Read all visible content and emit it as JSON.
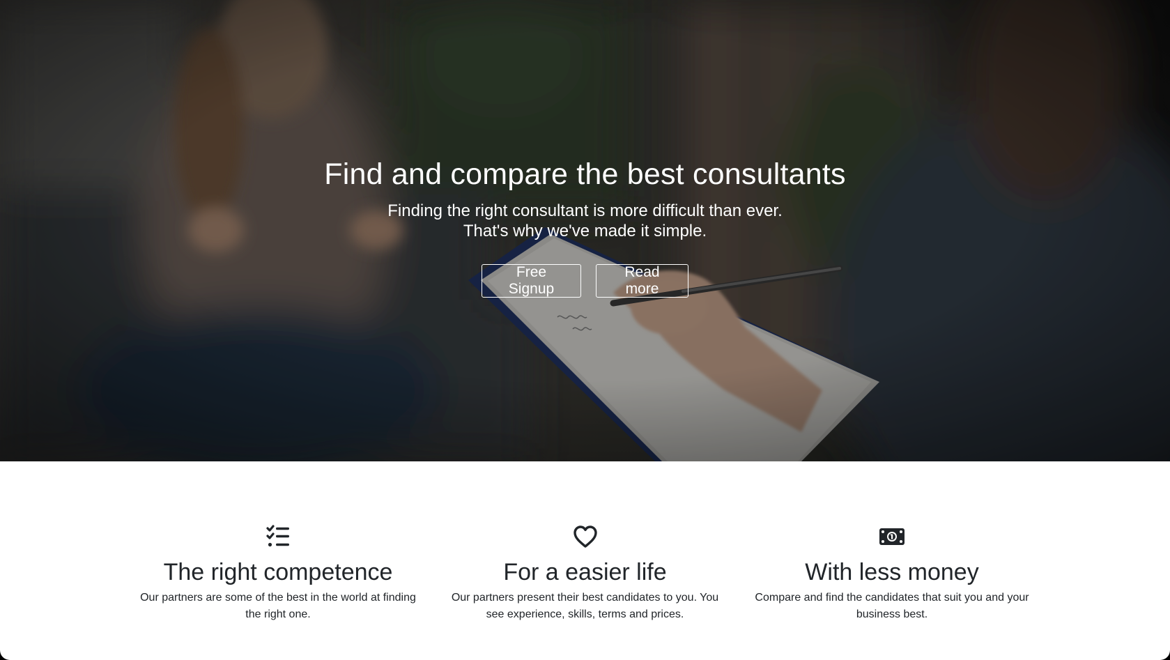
{
  "hero": {
    "title": "Find and compare the best consultants",
    "subtitle_line1": "Finding the right consultant is more difficult than ever.",
    "subtitle_line2": "That's why we've made it simple.",
    "primary_button": "Free Signup",
    "secondary_button": "Read more"
  },
  "features": [
    {
      "icon": "checklist-icon",
      "title": "The right competence",
      "text": "Our partners are some of the best in the world at finding the right one."
    },
    {
      "icon": "heart-icon",
      "title": "For a easier life",
      "text": "Our partners present their best candidates to you. You see experience, skills, terms and prices."
    },
    {
      "icon": "money-icon",
      "title": "With less money",
      "text": "Compare and find the candidates that suit you and your business best."
    }
  ],
  "colors": {
    "hero_text": "#ffffff",
    "body_text": "#212529",
    "icon": "#212529",
    "background": "#ffffff"
  }
}
